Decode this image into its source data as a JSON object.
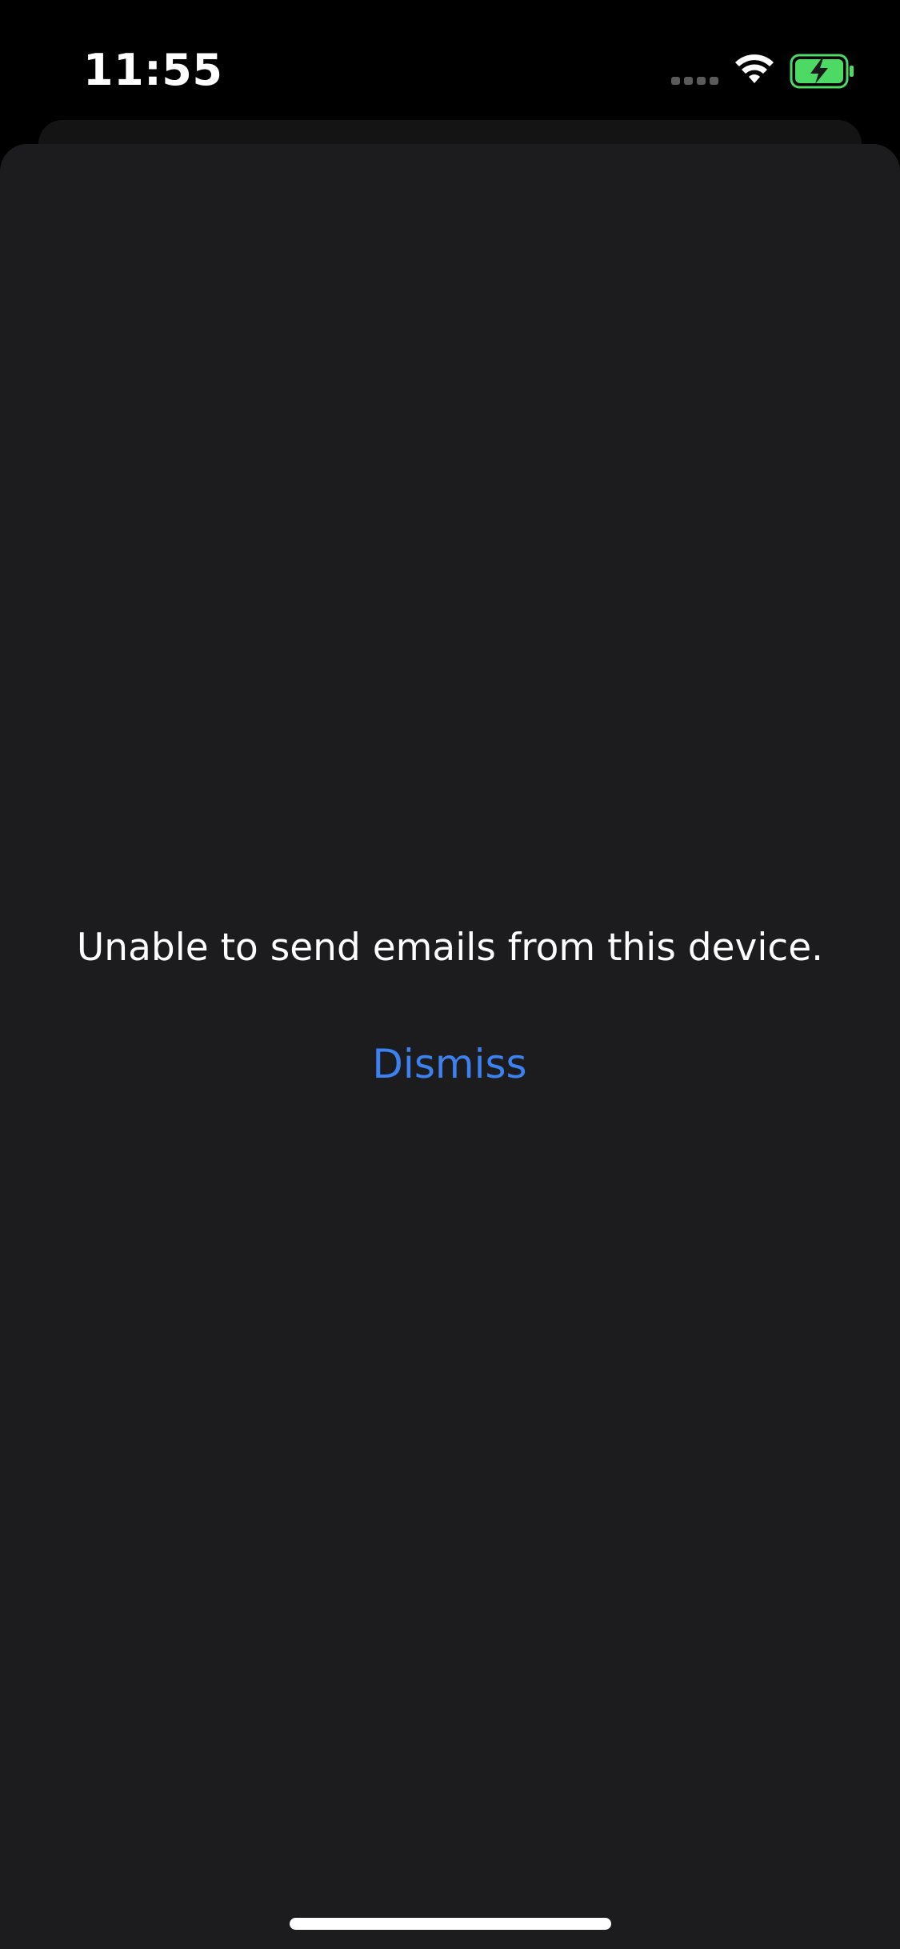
{
  "status_bar": {
    "time": "11:55",
    "signal_icon": "cellular-signal-dots",
    "wifi_icon": "wifi-icon",
    "battery_icon": "battery-charging-icon",
    "battery_color": "#4cd964"
  },
  "alert": {
    "message": "Unable to send emails from this device.",
    "dismiss_label": "Dismiss",
    "accent_color": "#3b82f0"
  },
  "colors": {
    "background": "#000000",
    "sheet": "#1c1c1e",
    "text": "#ffffff"
  }
}
